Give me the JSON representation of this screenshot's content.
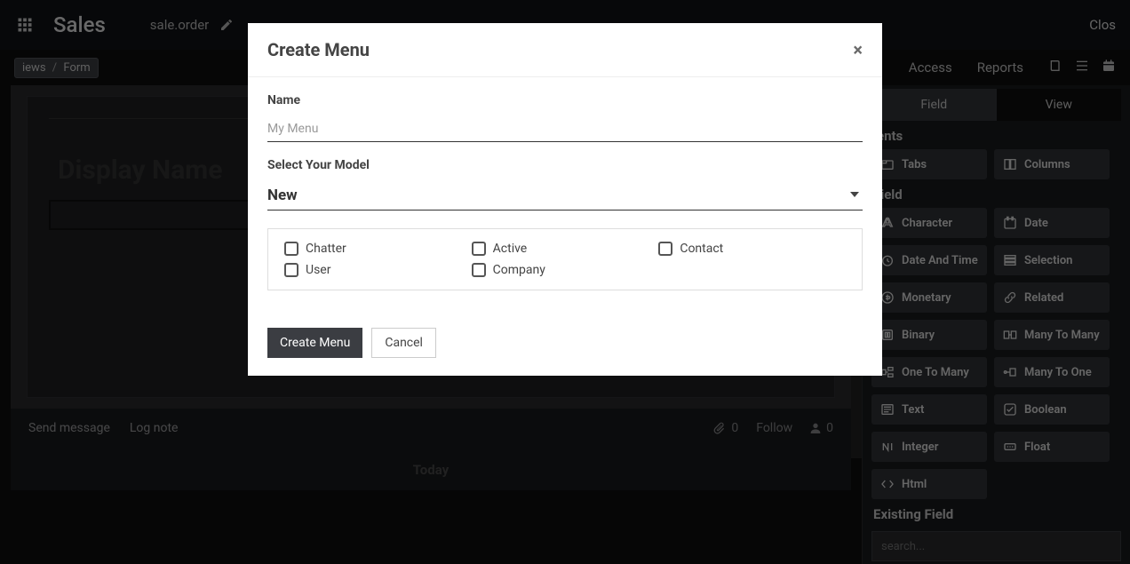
{
  "navbar": {
    "app_name": "Sales",
    "model": "sale.order",
    "close": "Clos"
  },
  "secondbar": {
    "crumb_views": "iews",
    "crumb_form": "Form",
    "access": "Access",
    "reports": "Reports"
  },
  "form": {
    "display_name_label": "Display Name"
  },
  "chatter": {
    "send": "Send message",
    "log": "Log note",
    "attach_count": "0",
    "follow": "Follow",
    "followers_count": "0",
    "today": "Today"
  },
  "sidebar": {
    "tab_field": "Field",
    "tab_view": "View",
    "section_elements_partial": "ients",
    "chip_tabs": "Tabs",
    "chip_columns": "Columns",
    "section_new_field": "Field",
    "chips_new": [
      {
        "label": "Character",
        "icon": "char"
      },
      {
        "label": "Date",
        "icon": "date"
      },
      {
        "label": "Date And Time",
        "icon": "datetime"
      },
      {
        "label": "Selection",
        "icon": "selection"
      },
      {
        "label": "Monetary",
        "icon": "money"
      },
      {
        "label": "Related",
        "icon": "related"
      },
      {
        "label": "Binary",
        "icon": "binary"
      },
      {
        "label": "Many To Many",
        "icon": "m2m"
      },
      {
        "label": "One To Many",
        "icon": "o2m"
      },
      {
        "label": "Many To One",
        "icon": "m2o"
      },
      {
        "label": "Text",
        "icon": "text"
      },
      {
        "label": "Boolean",
        "icon": "bool"
      },
      {
        "label": "Integer",
        "icon": "int"
      },
      {
        "label": "Float",
        "icon": "float"
      },
      {
        "label": "Html",
        "icon": "html"
      }
    ],
    "section_existing": "Existing Field",
    "search_placeholder": "search..."
  },
  "modal": {
    "title": "Create Menu",
    "name_label": "Name",
    "name_placeholder": "My Menu",
    "model_label": "Select Your Model",
    "model_value": "New",
    "options": [
      "Chatter",
      "Active",
      "Contact",
      "User",
      "Company"
    ],
    "btn_primary": "Create Menu",
    "btn_cancel": "Cancel"
  }
}
